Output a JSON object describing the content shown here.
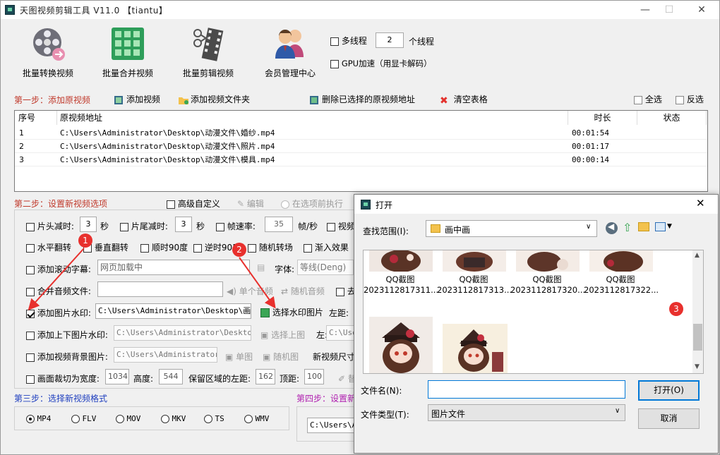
{
  "window": {
    "title": "天图视频剪辑工具 V11.0  【tiantu】",
    "minimize": "—",
    "maximize": "☐",
    "close": "✕"
  },
  "toolbar": [
    {
      "label": "批量转换视频"
    },
    {
      "label": "批量合并视频"
    },
    {
      "label": "批量剪辑视频"
    },
    {
      "label": "会员管理中心"
    }
  ],
  "threads": {
    "multi_label": "多线程",
    "value": "2",
    "unit": "个线程",
    "gpu_label": "GPU加速（用显卡解码）"
  },
  "step1": {
    "title": "第一步：添加原视频",
    "add_video": "添加视频",
    "add_folder": "添加视频文件夹",
    "delete_selected": "删除已选择的原视频地址",
    "clear_table": "清空表格",
    "select_all": "全选",
    "invert": "反选"
  },
  "table": {
    "headers": [
      "序号",
      "原视频地址",
      "时长",
      "状态"
    ],
    "rows": [
      {
        "index": "1",
        "path": "C:\\Users\\Administrator\\Desktop\\动漫文件\\婚纱.mp4",
        "duration": "00:01:54",
        "status": ""
      },
      {
        "index": "2",
        "path": "C:\\Users\\Administrator\\Desktop\\动漫文件\\照片.mp4",
        "duration": "00:01:17",
        "status": ""
      },
      {
        "index": "3",
        "path": "C:\\Users\\Administrator\\Desktop\\动漫文件\\模具.mp4",
        "duration": "00:00:14",
        "status": ""
      }
    ]
  },
  "step2": {
    "title": "第二步：设置新视频选项",
    "advanced": "高级自定义",
    "edit": "编辑",
    "before_run": "在选项前执行",
    "head_cut": "片头减时:",
    "head_val": "3",
    "sec1": "秒",
    "tail_cut": "片尾减时:",
    "tail_val": "3",
    "sec2": "秒",
    "fps": "帧速率:",
    "fps_val": "35",
    "fps_unit": "帧/秒",
    "video_more": "视频",
    "hflip": "水平翻转",
    "vflip": "垂直翻转",
    "rot90": "顺时90度",
    "rot_ccw": "逆时90度",
    "random_trans": "随机转场",
    "fade_in": "渐入效果",
    "subtitle": "添加滚动字幕:",
    "subtitle_val": "网页加载中",
    "font_label": "字体:",
    "font_val": "等线(Deng)",
    "merge_audio": "合并音频文件:",
    "single_audio": "单个音频",
    "random_audio": "随机音频",
    "remove": "去",
    "img_wm": "添加图片水印:",
    "img_wm_val": "C:\\Users\\Administrator\\Desktop\\画中画",
    "choose_wm": "选择水印图片",
    "left_margin": "左距:",
    "tb_wm": "添加上下图片水印:",
    "tb_wm_val": "C:\\Users\\Administrator\\Desktop\\",
    "choose_top": "选择上图",
    "left_short": "左:",
    "left_short_val": "C:\\Users\\",
    "bg_img": "添加视频背景图片:",
    "bg_img_val": "C:\\Users\\Administrator\\D",
    "single_img": "单图",
    "random_img": "随机图",
    "new_size": "新视频尺寸",
    "crop": "画面裁切为宽度:",
    "crop_w": "1034",
    "crop_h_label": "高度:",
    "crop_h": "544",
    "keep_left": "保留区域的左距:",
    "keep_left_val": "162",
    "top_label": "顶距:",
    "top_val": "100",
    "more": "替"
  },
  "step3": {
    "title": "第三步：选择新视频格式",
    "formats": [
      "MP4",
      "FLV",
      "MOV",
      "MKV",
      "TS",
      "WMV"
    ]
  },
  "step4": {
    "title": "第四步：设置新",
    "path": "C:\\Users\\Ad"
  },
  "dialog": {
    "title": "打开",
    "look_in_label": "查找范围(I):",
    "look_in_value": "画中画",
    "files_row1": [
      {
        "name1": "QQ截图",
        "name2": "2023112817311..."
      },
      {
        "name1": "QQ截图",
        "name2": "2023112817313..."
      },
      {
        "name1": "QQ截图",
        "name2": "2023112817320..."
      },
      {
        "name1": "QQ截图",
        "name2": "2023112817322..."
      }
    ],
    "filename_label": "文件名(N):",
    "filename_value": "",
    "filetype_label": "文件类型(T):",
    "filetype_value": "图片文件",
    "open_btn": "打开(O)",
    "cancel_btn": "取消"
  },
  "badges": [
    "1",
    "2",
    "3"
  ],
  "colors": {
    "step_red": "#c0392b",
    "step_blue": "#1f3fbf",
    "step_purple": "#b021b0",
    "badge": "#e8302d",
    "focus": "#0078d7"
  }
}
